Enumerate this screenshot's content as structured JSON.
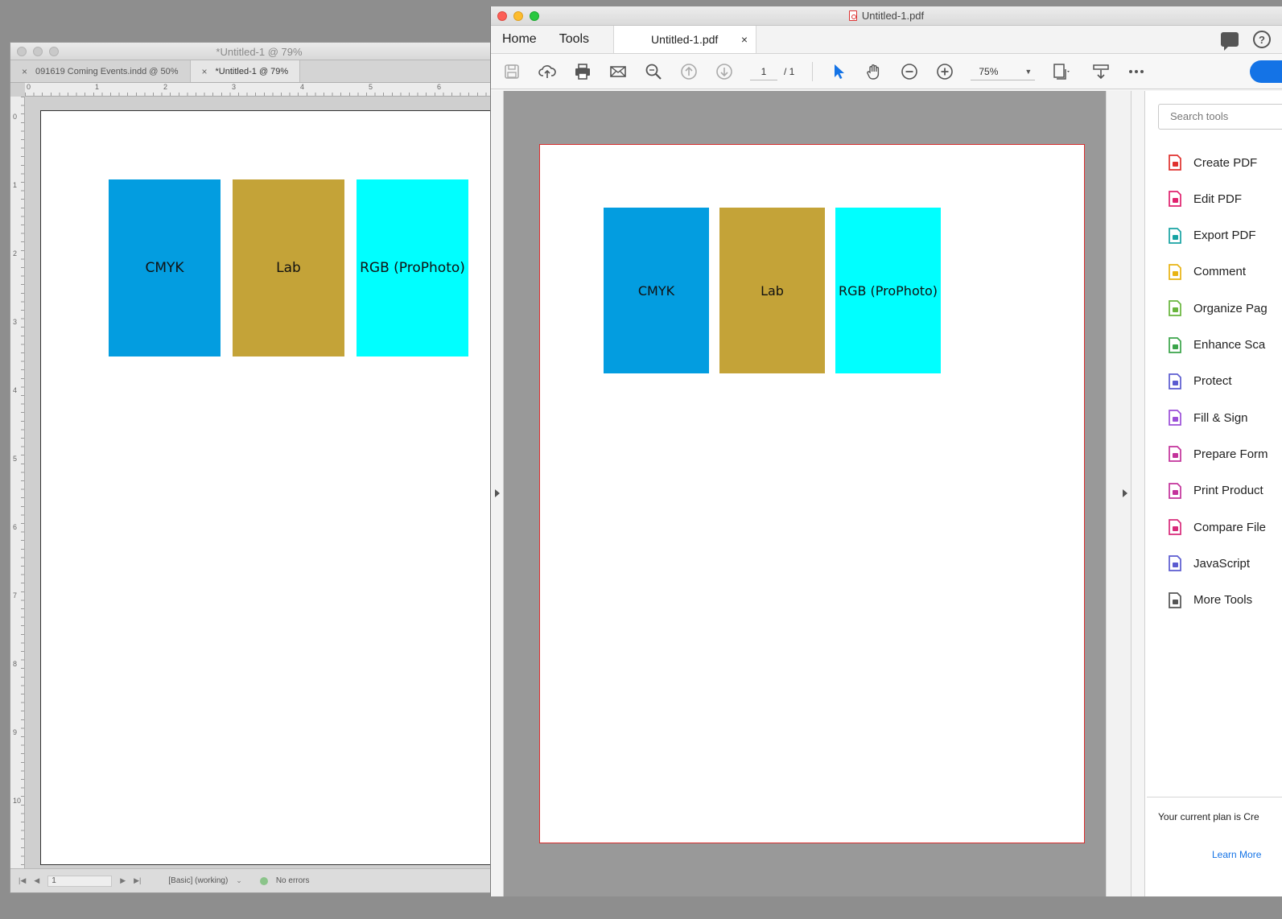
{
  "indesign": {
    "window_title": "*Untitled-1 @ 79%",
    "tabs": [
      {
        "label": "091619 Coming Events.indd @ 50%",
        "close": "×"
      },
      {
        "label": "*Untitled-1 @ 79%",
        "close": "×"
      }
    ],
    "ruler_h": [
      "0",
      "1",
      "2",
      "3",
      "4",
      "5",
      "6"
    ],
    "ruler_v": [
      "0",
      "1",
      "2",
      "3",
      "4",
      "5",
      "6",
      "7",
      "8",
      "9",
      "10"
    ],
    "swatches": [
      {
        "label": "CMYK",
        "color": "#039de0"
      },
      {
        "label": "Lab",
        "color": "#c4a338"
      },
      {
        "label": "RGB (ProPhoto)",
        "color": "#00ffff"
      }
    ],
    "status": {
      "page": "1",
      "style": "[Basic] (working)",
      "preflight": "No errors"
    }
  },
  "acrobat": {
    "window_title": "Untitled-1.pdf",
    "nav": {
      "home": "Home",
      "tools": "Tools",
      "doc_tab": "Untitled-1.pdf",
      "close": "×"
    },
    "toolbar": {
      "page_current": "1",
      "page_total": "/ 1",
      "zoom": "75%"
    },
    "swatches": [
      {
        "label": "CMYK",
        "color": "#039de0"
      },
      {
        "label": "Lab",
        "color": "#c4a338"
      },
      {
        "label": "RGB (ProPhoto)",
        "color": "#00ffff"
      }
    ],
    "tools_pane": {
      "search_placeholder": "Search tools",
      "items": [
        {
          "label": "Create PDF",
          "icon": "create-pdf-icon",
          "color": "#e0312e"
        },
        {
          "label": "Edit PDF",
          "icon": "edit-pdf-icon",
          "color": "#e0226e"
        },
        {
          "label": "Export PDF",
          "icon": "export-pdf-icon",
          "color": "#17a3a3"
        },
        {
          "label": "Comment",
          "icon": "comment-icon",
          "color": "#e8b312"
        },
        {
          "label": "Organize Pag",
          "icon": "organize-pages-icon",
          "color": "#68b53c"
        },
        {
          "label": "Enhance Sca",
          "icon": "enhance-scans-icon",
          "color": "#3aa449"
        },
        {
          "label": "Protect",
          "icon": "protect-icon",
          "color": "#5b5bd0"
        },
        {
          "label": "Fill & Sign",
          "icon": "fill-sign-icon",
          "color": "#9b4fd8"
        },
        {
          "label": "Prepare Form",
          "icon": "prepare-form-icon",
          "color": "#c3329b"
        },
        {
          "label": "Print Product",
          "icon": "print-production-icon",
          "color": "#c3329b"
        },
        {
          "label": "Compare File",
          "icon": "compare-files-icon",
          "color": "#d82a7a"
        },
        {
          "label": "JavaScript",
          "icon": "javascript-icon",
          "color": "#5b5bd0"
        },
        {
          "label": "More Tools",
          "icon": "more-tools-icon",
          "color": "#555555"
        }
      ],
      "plan_text": "Your current plan is Cre",
      "learn_more": "Learn More"
    }
  }
}
